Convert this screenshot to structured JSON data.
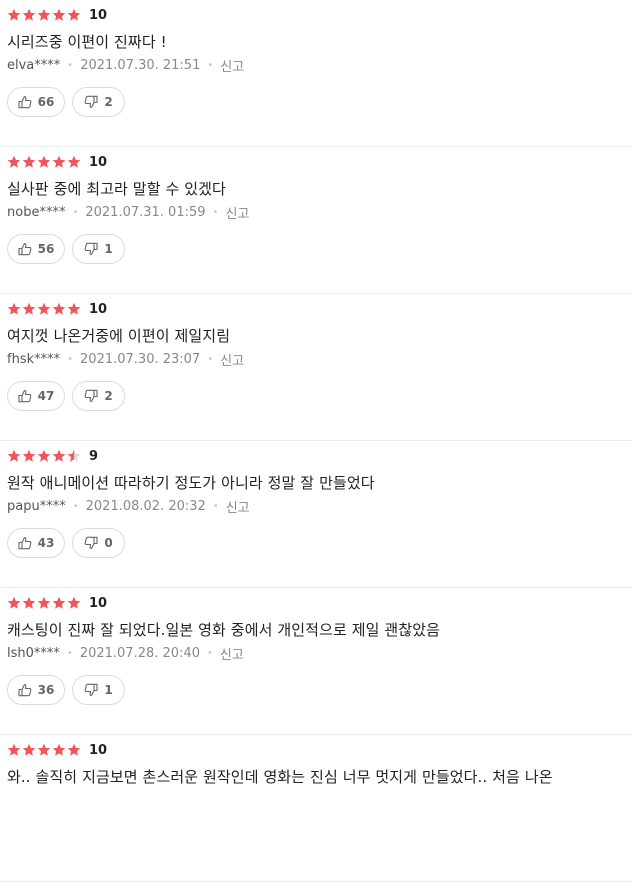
{
  "reviews": [
    {
      "stars": 5,
      "score": "10",
      "text": "시리즈중 이편이 진짜다 !",
      "user": "elva****",
      "date": "2021.07.30. 21:51",
      "report": "신고",
      "likes": "66",
      "dislikes": "2"
    },
    {
      "stars": 5,
      "score": "10",
      "text": "실사판 중에 최고라 말할 수 있겠다",
      "user": "nobe****",
      "date": "2021.07.31. 01:59",
      "report": "신고",
      "likes": "56",
      "dislikes": "1"
    },
    {
      "stars": 5,
      "score": "10",
      "text": "여지껏 나온거중에 이편이 제일지림",
      "user": "fhsk****",
      "date": "2021.07.30. 23:07",
      "report": "신고",
      "likes": "47",
      "dislikes": "2"
    },
    {
      "stars": 4.5,
      "score": "9",
      "text": "원작 애니메이션 따라하기 정도가 아니라 정말 잘 만들었다",
      "user": "papu****",
      "date": "2021.08.02. 20:32",
      "report": "신고",
      "likes": "43",
      "dislikes": "0"
    },
    {
      "stars": 5,
      "score": "10",
      "text": "캐스팅이 진짜 잘 되었다.일본 영화 중에서 개인적으로 제일 괜찮았음",
      "user": "lsh0****",
      "date": "2021.07.28. 20:40",
      "report": "신고",
      "likes": "36",
      "dislikes": "1"
    },
    {
      "stars": 5,
      "score": "10",
      "text": "와.. 솔직히 지금보면 촌스러운 원작인데 영화는 진심 너무 멋지게 만들었다.. 처음 나온",
      "user": "",
      "date": "",
      "report": "",
      "likes": "",
      "dislikes": ""
    }
  ],
  "colors": {
    "star": "#f0555b",
    "star_empty": "#d8d8d8"
  },
  "icons": {
    "like": "thumbs-up-icon",
    "dislike": "thumbs-down-icon"
  }
}
